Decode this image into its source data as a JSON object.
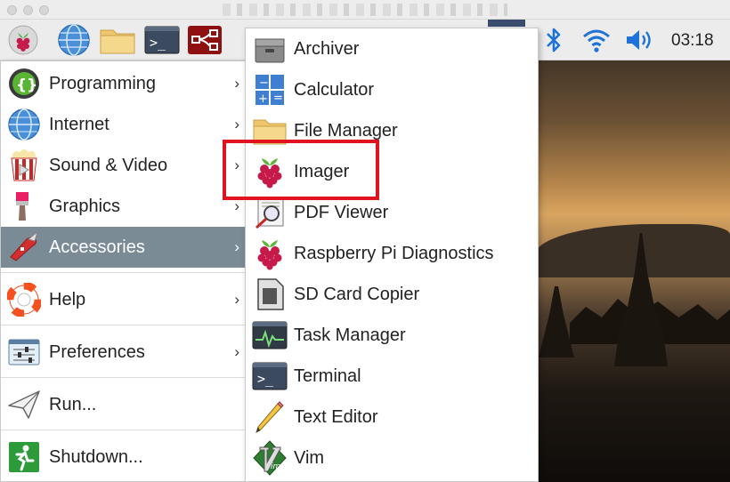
{
  "panel": {
    "clock": "03:18",
    "launchers": [
      "raspberry-icon",
      "globe-icon",
      "folder-icon",
      "terminal-icon",
      "network-icon"
    ],
    "tray": [
      "bluetooth-icon",
      "wifi-icon",
      "volume-icon"
    ]
  },
  "main_menu": {
    "items": [
      {
        "label": "Programming",
        "icon": "programming-icon",
        "submenu": true
      },
      {
        "label": "Internet",
        "icon": "globe-icon",
        "submenu": true
      },
      {
        "label": "Sound & Video",
        "icon": "popcorn-icon",
        "submenu": true
      },
      {
        "label": "Graphics",
        "icon": "paintbrush-icon",
        "submenu": true
      },
      {
        "label": "Accessories",
        "icon": "knife-icon",
        "submenu": true,
        "active": true
      },
      {
        "label": "Help",
        "icon": "lifebuoy-icon",
        "submenu": true
      },
      {
        "label": "Preferences",
        "icon": "sliders-icon",
        "submenu": true
      },
      {
        "label": "Run...",
        "icon": "paper-plane-icon",
        "submenu": false
      },
      {
        "label": "Shutdown...",
        "icon": "exit-icon",
        "submenu": false
      }
    ],
    "arrow_glyph": "›"
  },
  "accessories_menu": {
    "items": [
      {
        "label": "Archiver",
        "icon": "archive-icon"
      },
      {
        "label": "Calculator",
        "icon": "calculator-icon"
      },
      {
        "label": "File Manager",
        "icon": "folder-icon"
      },
      {
        "label": "Imager",
        "icon": "raspberry-icon",
        "highlighted": true
      },
      {
        "label": "PDF Viewer",
        "icon": "pdf-viewer-icon"
      },
      {
        "label": "Raspberry Pi Diagnostics",
        "icon": "raspberry-icon"
      },
      {
        "label": "SD Card Copier",
        "icon": "sd-card-icon"
      },
      {
        "label": "Task Manager",
        "icon": "task-manager-icon"
      },
      {
        "label": "Terminal",
        "icon": "terminal-icon"
      },
      {
        "label": "Text Editor",
        "icon": "pencil-icon"
      },
      {
        "label": "Vim",
        "icon": "vim-icon"
      }
    ]
  },
  "colors": {
    "active_row": "#7a8b95",
    "highlight": "#e0141e",
    "raspberry": "#c51a4a"
  }
}
